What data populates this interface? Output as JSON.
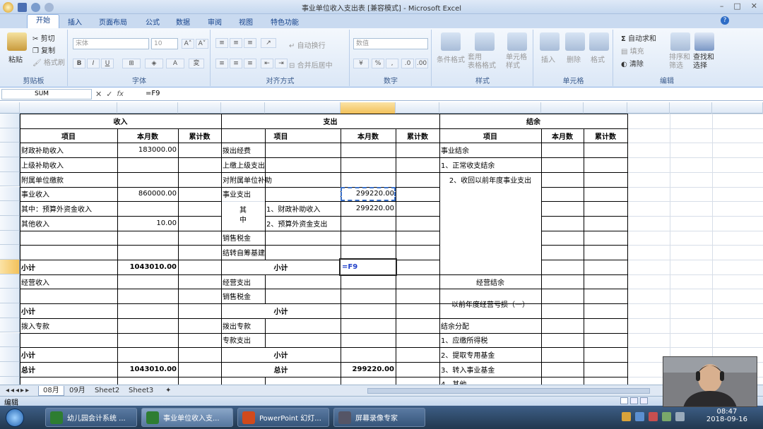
{
  "app": {
    "title": "事业单位收入支出表 [兼容模式] - Microsoft Excel",
    "ribbon_tabs": [
      "开始",
      "插入",
      "页面布局",
      "公式",
      "数据",
      "审阅",
      "视图",
      "特色功能"
    ]
  },
  "ribbon": {
    "clipboard": {
      "paste": "粘贴",
      "cut": "剪切",
      "copy": "复制",
      "format_painter": "格式刷",
      "label": "剪贴板"
    },
    "font": {
      "font_name": "宋体",
      "font_size": "10",
      "label": "字体"
    },
    "alignment": {
      "wrap": "自动换行",
      "merge": "合并后居中",
      "label": "对齐方式"
    },
    "number": {
      "format": "数值",
      "label": "数字"
    },
    "styles": {
      "cond": "条件格式",
      "table": "套用\n表格格式",
      "cell": "单元格\n样式",
      "label": "样式"
    },
    "cells": {
      "insert": "插入",
      "delete": "删除",
      "format": "格式",
      "label": "单元格"
    },
    "editing": {
      "autosum": "自动求和",
      "fill": "填充",
      "clear": "清除",
      "sort": "排序和\n筛选",
      "find": "查找和\n选择",
      "label": "编辑"
    }
  },
  "formula_bar": {
    "name_box": "SUM",
    "formula": "=F9"
  },
  "columns": [
    "A",
    "B",
    "C",
    "D",
    "E",
    "F",
    "G",
    "H",
    "I",
    "J",
    "K",
    "L",
    "M"
  ],
  "rows": [
    "4",
    "5",
    "6",
    "7",
    "8",
    "9",
    "10",
    "11",
    "12",
    "13",
    "14",
    "15",
    "16",
    "17",
    "18",
    "19",
    "20",
    "21",
    "22"
  ],
  "sheet": {
    "sections": {
      "income": "收入",
      "expense": "支出",
      "balance": "结余"
    },
    "headers": {
      "item": "项目",
      "month": "本月数",
      "cumulative": "累计数"
    },
    "A": {
      "r6": "财政补助收入",
      "r7": "上级补助收入",
      "r8": "附属单位缴款",
      "r9": "事业收入",
      "r10": "其中：预算外资金收入",
      "r11": "其他收入",
      "r14": "小计",
      "r15": "经营收入",
      "r17": "小计",
      "r18": "拨入专款",
      "r20": "小计",
      "r21": "总计"
    },
    "B": {
      "r6": "183000.00",
      "r9": "860000.00",
      "r11": "10.00",
      "r14": "1043010.00",
      "r21": "1043010.00"
    },
    "D": {
      "r6": "拨出经费",
      "r7": "上缴上级支出",
      "r8": "对附属单位补助",
      "r9": "事业支出",
      "r10_11": "其\n中",
      "r12": "销售税金",
      "r13": "结转自筹基建",
      "r14": "小计",
      "r15": "经营支出",
      "r16": "销售税金",
      "r17": "小计",
      "r18": "拨出专款",
      "r19": "专款支出",
      "r20": "小计",
      "r21": "总计"
    },
    "E": {
      "r10": "1、财政补助收入",
      "r11": "2、预算外资金支出"
    },
    "F": {
      "r9": "299220.00",
      "r10": "299220.00",
      "r14": "=F9",
      "r21": "299220.00"
    },
    "H": {
      "r6": "事业结余",
      "r7": "1、正常收支结余",
      "r8": "2、收回以前年度事业支出",
      "r15": "经营结余",
      "r16": "以前年度经营亏损（一）",
      "r18": "结余分配",
      "r19": "1、应缴所得税",
      "r20": "2、提取专用基金",
      "r21": "3、转入事业基金",
      "r22": "4、其他"
    }
  },
  "sheet_tabs": [
    "08月",
    "09月",
    "Sheet2",
    "Sheet3"
  ],
  "status": {
    "mode": "编辑"
  },
  "taskbar": {
    "items": [
      "幼儿园会计系统 ...",
      "事业单位收入支...",
      "PowerPoint 幻灯...",
      "屏幕录像专家"
    ],
    "time": "08:47",
    "date": "2018-09-16"
  },
  "colors": {
    "accent": "#15428b",
    "selection": "#3a70c8",
    "formula_blue": "#1f3fc9"
  }
}
